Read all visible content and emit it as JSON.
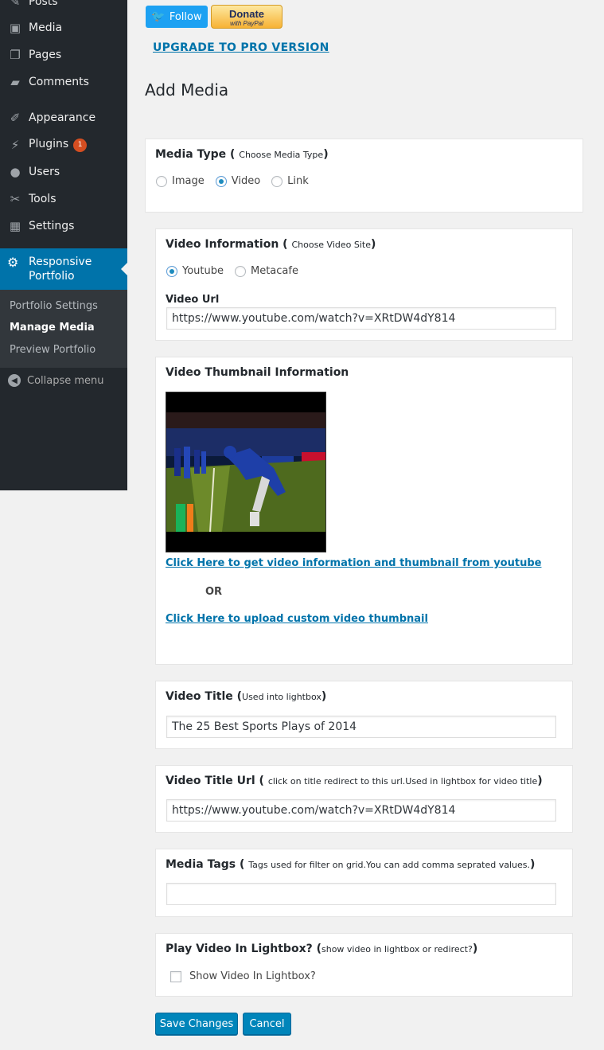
{
  "sidebar": {
    "items": [
      {
        "label": "Posts",
        "icon": "pin-icon"
      },
      {
        "label": "Media",
        "icon": "media-icon"
      },
      {
        "label": "Pages",
        "icon": "pages-icon"
      },
      {
        "label": "Comments",
        "icon": "comments-icon"
      },
      {
        "label": "Appearance",
        "icon": "brush-icon"
      },
      {
        "label": "Plugins",
        "icon": "plugin-icon",
        "badge": "1"
      },
      {
        "label": "Users",
        "icon": "user-icon"
      },
      {
        "label": "Tools",
        "icon": "wrench-icon"
      },
      {
        "label": "Settings",
        "icon": "settings-icon"
      }
    ],
    "active": {
      "label": "Responsive Portfolio",
      "icon": "gear-icon"
    },
    "submenu": [
      "Portfolio Settings",
      "Manage Media",
      "Preview Portfolio"
    ],
    "collapse_label": "Collapse menu"
  },
  "header": {
    "follow_label": "Follow",
    "donate_label": "Donate",
    "donate_sub": "with PayPal",
    "upgrade_label": "UPGRADE TO PRO VERSION",
    "page_title": "Add Media"
  },
  "media_type": {
    "title": "Media Type",
    "hint": "Choose Media Type",
    "options": [
      "Image",
      "Video",
      "Link"
    ],
    "selected": "Video"
  },
  "video_info": {
    "title": "Video Information",
    "hint": "Choose Video Site",
    "options": [
      "Youtube",
      "Metacafe"
    ],
    "selected": "Youtube",
    "url_label": "Video Url",
    "url_value": "https://www.youtube.com/watch?v=XRtDW4dY814"
  },
  "thumbnail": {
    "title": "Video Thumbnail Information",
    "get_link": "Click Here to get video information and thumbnail from youtube",
    "or_text": "OR",
    "upload_link": "Click Here to upload custom video thumbnail"
  },
  "video_title": {
    "title": "Video Title",
    "hint": "Used into lightbox",
    "value": "The 25 Best Sports Plays of 2014"
  },
  "video_title_url": {
    "title": "Video Title Url",
    "hint": "click on title redirect to this url.Used in lightbox for video title",
    "value": "https://www.youtube.com/watch?v=XRtDW4dY814"
  },
  "media_tags": {
    "title": "Media Tags",
    "hint": "Tags used for filter on grid.You can add comma seprated values.",
    "value": ""
  },
  "lightbox": {
    "title": "Play Video In Lightbox?",
    "hint": "show video in lightbox or redirect?",
    "checkbox_label": "Show Video In Lightbox?",
    "checked": false
  },
  "actions": {
    "save_label": "Save Changes",
    "cancel_label": "Cancel"
  },
  "colors": {
    "sidebar_bg": "#23282d",
    "active_bg": "#0073aa",
    "link": "#0073aa",
    "button": "#0085ba"
  }
}
